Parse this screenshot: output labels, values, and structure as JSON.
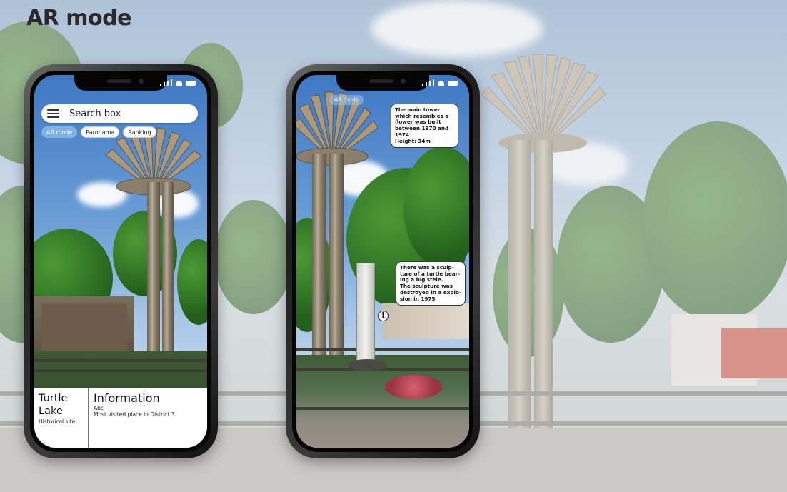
{
  "page": {
    "title": "AR mode"
  },
  "phone_browse": {
    "search": {
      "placeholder": "Search box"
    },
    "chips": [
      {
        "label": "AR mode",
        "active": true
      },
      {
        "label": "Paronama",
        "active": false
      },
      {
        "label": "Ranking",
        "active": false
      }
    ],
    "info": {
      "place_name": "Turtle Lake",
      "place_type": "Historical site",
      "section_title": "Information",
      "lines": [
        "Abc",
        "Most visited place in District 3"
      ]
    }
  },
  "phone_ar": {
    "badge": "AR mode",
    "callout_tower": {
      "lines": [
        "The main tower",
        "which resembles a",
        "flower was built",
        "between 1970 and",
        "1974",
        "Height: 34m"
      ]
    },
    "callout_sculpture": {
      "lines": [
        "There was a sculp-",
        "ture of a turtle bear-",
        "ing a big stele.",
        "The sculpture was",
        "destroyed in a explo-",
        "sion in 1975"
      ]
    },
    "marker_glyph": "i"
  },
  "colors": {
    "chip_active": "#7fb2e5",
    "title_text": "#2a2a2a",
    "phone_frame": "#1c1c1c"
  },
  "icons": [
    "menu-icon",
    "signal-icon",
    "wifi-icon",
    "battery-icon",
    "info-marker-icon"
  ]
}
